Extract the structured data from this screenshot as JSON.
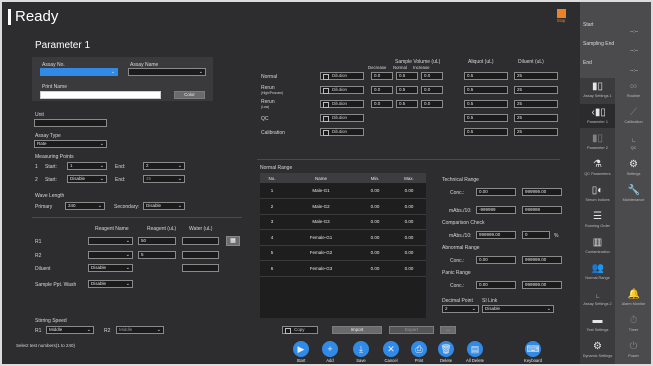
{
  "status": {
    "title": "Ready",
    "stop_label": "Stop"
  },
  "page_title": "Parameter 1",
  "assay": {
    "no_label": "Assay No.",
    "no_value": "",
    "name_label": "Assay Name",
    "name_value": "",
    "print_label": "Print Name",
    "print_value": "",
    "color_label": "Color"
  },
  "unit_label": "Unit",
  "unit_value": "",
  "assay_type": {
    "label": "Assay Type",
    "value": "Rate"
  },
  "measuring": {
    "label": "Measuring Points",
    "row1": {
      "num": "1",
      "start_label": "Start:",
      "start_value": "1",
      "end_label": "End:",
      "end_value": "2"
    },
    "row2": {
      "num": "2",
      "start_label": "Start:",
      "start_value": "Disable",
      "end_label": "End:",
      "end_value": "35"
    }
  },
  "wavelength": {
    "label": "Wave Length",
    "primary_label": "Primary",
    "primary_value": "340",
    "secondary_label": "Secondary:",
    "secondary_value": "Disable"
  },
  "reagents": {
    "hdr_name": "Reagent Name",
    "hdr_ul": "Reagent (uL)",
    "hdr_water": "Water (uL)",
    "r1_label": "R1",
    "r1_name": "",
    "r1_ul": "50",
    "r1_water": "",
    "r2_label": "R2",
    "r2_name": "",
    "r2_ul": "5",
    "r2_water": "",
    "diluent_label": "Diluent",
    "diluent_value": "Disable",
    "diluent_water": "",
    "wash_label": "Sample Ppt. Wash",
    "wash_value": "Disable"
  },
  "stirring": {
    "label": "Stirring Speed",
    "r1_label": "R1",
    "r1_value": "Middle",
    "r2_label": "R2",
    "r2_value": "Middle"
  },
  "hint": "Select test numbers(1 to 240)",
  "sample_volume": {
    "header": "Sample Volume (uL)",
    "decrease": "Decrease",
    "normal": "Normal",
    "increase": "Increase",
    "aliquot": "Aliquot (uL)",
    "diluent": "Diluent (uL)",
    "dilution": "Dilution",
    "rows": [
      {
        "label": "Normal",
        "sub": "",
        "dec": "0.0",
        "nor": "0.5",
        "inc": "0.0",
        "aliq": "0.5",
        "dil": "25"
      },
      {
        "label": "Rerun",
        "sub": "(High/Prozone)",
        "dec": "0.0",
        "nor": "0.5",
        "inc": "0.0",
        "aliq": "0.5",
        "dil": "25"
      },
      {
        "label": "Rerun",
        "sub": "(Low)",
        "dec": "0.0",
        "nor": "0.5",
        "inc": "0.0",
        "aliq": "0.5",
        "dil": "25"
      },
      {
        "label": "QC",
        "sub": "",
        "aliq": "0.5",
        "dil": "25"
      },
      {
        "label": "Calibration",
        "sub": "",
        "aliq": "0.5",
        "dil": "25"
      }
    ]
  },
  "normal_range": {
    "label": "Normal Range",
    "headers": [
      "No.",
      "Name",
      "Min.",
      "Max."
    ],
    "rows": [
      [
        "1",
        "Male-G1",
        "0.00",
        "0.00"
      ],
      [
        "2",
        "Male-G2",
        "0.00",
        "0.00"
      ],
      [
        "3",
        "Male-G3",
        "0.00",
        "0.00"
      ],
      [
        "4",
        "Female-G1",
        "0.00",
        "0.00"
      ],
      [
        "5",
        "Female-G2",
        "0.00",
        "0.00"
      ],
      [
        "6",
        "Female-G3",
        "0.00",
        "0.00"
      ]
    ],
    "copy_label": "Copy",
    "import_label": "Import",
    "export_label": "Export",
    "more_label": "..."
  },
  "technical": {
    "label": "Technical Range",
    "conc_label": "Conc.:",
    "conc_min": "0.00",
    "conc_max": "999999.00",
    "mabs_label": "mAbs./10:",
    "mabs_min": "-999999",
    "mabs_max": "999999"
  },
  "comparison": {
    "label": "Comparison Check",
    "mabs_label": "mAbs./10:",
    "value": "999999.00",
    "pct": "0",
    "unit": "%"
  },
  "abnormal": {
    "label": "Abnormal Range",
    "conc_label": "Conc.:",
    "min": "0.00",
    "max": "999999.00"
  },
  "panic": {
    "label": "Panic Range",
    "conc_label": "Conc.:",
    "min": "0.00",
    "max": "999999.00"
  },
  "decimal": {
    "label": "Decimal Point",
    "value": "2"
  },
  "slink": {
    "label": "SI Link",
    "value": "Disable"
  },
  "toolbar": {
    "start": "Start",
    "add": "Add",
    "save": "Save",
    "cancel": "Cancel",
    "print": "Print",
    "delete": "Delete",
    "all_delete": "All Delete",
    "keyboard": "Keyboard"
  },
  "sidebar": {
    "start_label": "Start",
    "start_time": "--:--",
    "sampling_label": "Sampling End",
    "sampling_time": "--:--",
    "end_label": "End",
    "end_time": "--:--",
    "left_items": [
      "Assay Settings 1",
      "Parameter 1",
      "Parameter 2",
      "QC Parameters",
      "Serum Indices",
      "Running Order",
      "Contamination",
      "Normal Range",
      "Assay Settings 2",
      "Test Settings",
      "Dynamic Settings"
    ],
    "right_items": [
      "Routine",
      "Calibration",
      "QC",
      "Settings",
      "Maintenance",
      "Alarm Monitor",
      "Timer",
      "Power"
    ]
  },
  "colors": {
    "accent_blue": "#2f8ae8",
    "stop_orange": "#e8832a",
    "panel_bg": "#2d2d30"
  }
}
